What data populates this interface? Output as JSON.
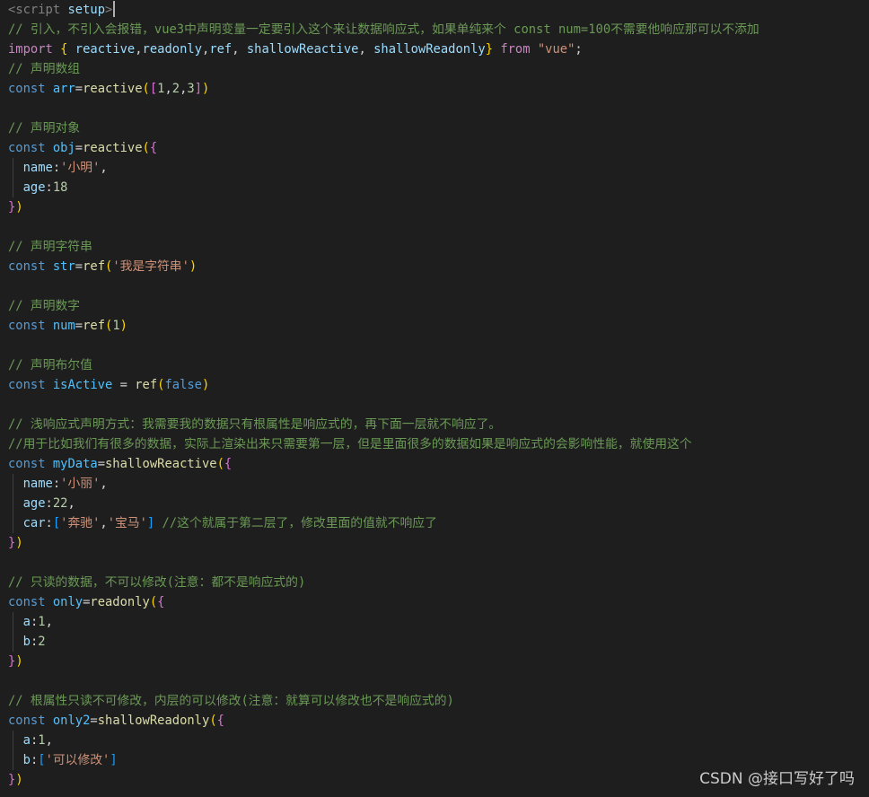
{
  "editor": {
    "language": "vue",
    "colors": {
      "background": "#1e1e1e",
      "comment": "#6a9955",
      "keyword": "#569cd6",
      "control_keyword": "#c586c0",
      "variable": "#4fc1ff",
      "property": "#9cdcfe",
      "function": "#dcdcaa",
      "string": "#ce9178",
      "number": "#b5cea8",
      "bracket_level1": "#ffd700",
      "bracket_level2": "#da70d6",
      "bracket_level3": "#179fff"
    },
    "lines": [
      [
        [
          "tag",
          "<"
        ],
        [
          "tag",
          "script "
        ],
        [
          "attr",
          "setup"
        ],
        [
          "tag",
          ">"
        ],
        [
          "cursor",
          ""
        ]
      ],
      [
        [
          "comment",
          "// 引入，不引入会报错，vue3中声明变量一定要引入这个来让数据响应式，如果单纯来个 const num=100不需要他响应那可以不添加"
        ]
      ],
      [
        [
          "keyword2",
          "import "
        ],
        [
          "brk1",
          "{ "
        ],
        [
          "prop",
          "reactive"
        ],
        [
          "plain",
          ","
        ],
        [
          "prop",
          "readonly"
        ],
        [
          "plain",
          ","
        ],
        [
          "prop",
          "ref"
        ],
        [
          "plain",
          ", "
        ],
        [
          "prop",
          "shallowReactive"
        ],
        [
          "plain",
          ", "
        ],
        [
          "prop",
          "shallowReadonly"
        ],
        [
          "brk1",
          "}"
        ],
        [
          "keyword2",
          " from "
        ],
        [
          "string",
          "\"vue\""
        ],
        [
          "plain",
          ";"
        ]
      ],
      [
        [
          "comment",
          "// 声明数组"
        ]
      ],
      [
        [
          "keyword",
          "const "
        ],
        [
          "var",
          "arr"
        ],
        [
          "plain",
          "="
        ],
        [
          "func",
          "reactive"
        ],
        [
          "brk1",
          "("
        ],
        [
          "brk2",
          "["
        ],
        [
          "number",
          "1"
        ],
        [
          "plain",
          ","
        ],
        [
          "number",
          "2"
        ],
        [
          "plain",
          ","
        ],
        [
          "number",
          "3"
        ],
        [
          "brk2",
          "]"
        ],
        [
          "brk1",
          ")"
        ]
      ],
      [],
      [
        [
          "comment",
          "// 声明对象"
        ]
      ],
      [
        [
          "keyword",
          "const "
        ],
        [
          "var",
          "obj"
        ],
        [
          "plain",
          "="
        ],
        [
          "func",
          "reactive"
        ],
        [
          "brk1",
          "("
        ],
        [
          "brk2",
          "{"
        ]
      ],
      [
        [
          "guide",
          ""
        ],
        [
          "plain",
          "  "
        ],
        [
          "prop",
          "name"
        ],
        [
          "plain",
          ":"
        ],
        [
          "string",
          "'小明'"
        ],
        [
          "plain",
          ","
        ]
      ],
      [
        [
          "guide",
          ""
        ],
        [
          "plain",
          "  "
        ],
        [
          "prop",
          "age"
        ],
        [
          "plain",
          ":"
        ],
        [
          "number",
          "18"
        ]
      ],
      [
        [
          "brk2",
          "}"
        ],
        [
          "brk1",
          ")"
        ]
      ],
      [],
      [
        [
          "comment",
          "// 声明字符串"
        ]
      ],
      [
        [
          "keyword",
          "const "
        ],
        [
          "var",
          "str"
        ],
        [
          "plain",
          "="
        ],
        [
          "func",
          "ref"
        ],
        [
          "brk1",
          "("
        ],
        [
          "string",
          "'我是字符串'"
        ],
        [
          "brk1",
          ")"
        ]
      ],
      [],
      [
        [
          "comment",
          "// 声明数字"
        ]
      ],
      [
        [
          "keyword",
          "const "
        ],
        [
          "var",
          "num"
        ],
        [
          "plain",
          "="
        ],
        [
          "func",
          "ref"
        ],
        [
          "brk1",
          "("
        ],
        [
          "number",
          "1"
        ],
        [
          "brk1",
          ")"
        ]
      ],
      [],
      [
        [
          "comment",
          "// 声明布尔值"
        ]
      ],
      [
        [
          "keyword",
          "const "
        ],
        [
          "var",
          "isActive"
        ],
        [
          "plain",
          " = "
        ],
        [
          "func",
          "ref"
        ],
        [
          "brk1",
          "("
        ],
        [
          "keyword",
          "false"
        ],
        [
          "brk1",
          ")"
        ]
      ],
      [],
      [
        [
          "comment",
          "// 浅响应式声明方式：我需要我的数据只有根属性是响应式的，再下面一层就不响应了。"
        ]
      ],
      [
        [
          "comment",
          "//用于比如我们有很多的数据，实际上渲染出来只需要第一层，但是里面很多的数据如果是响应式的会影响性能，就使用这个"
        ]
      ],
      [
        [
          "keyword",
          "const "
        ],
        [
          "var",
          "myData"
        ],
        [
          "plain",
          "="
        ],
        [
          "func",
          "shallowReactive"
        ],
        [
          "brk1",
          "("
        ],
        [
          "brk2",
          "{"
        ]
      ],
      [
        [
          "guide",
          ""
        ],
        [
          "plain",
          "  "
        ],
        [
          "prop",
          "name"
        ],
        [
          "plain",
          ":"
        ],
        [
          "string",
          "'小丽'"
        ],
        [
          "plain",
          ","
        ]
      ],
      [
        [
          "guide",
          ""
        ],
        [
          "plain",
          "  "
        ],
        [
          "prop",
          "age"
        ],
        [
          "plain",
          ":"
        ],
        [
          "number",
          "22"
        ],
        [
          "plain",
          ","
        ]
      ],
      [
        [
          "guide",
          ""
        ],
        [
          "plain",
          "  "
        ],
        [
          "prop",
          "car"
        ],
        [
          "plain",
          ":"
        ],
        [
          "brk3",
          "["
        ],
        [
          "string",
          "'奔驰'"
        ],
        [
          "plain",
          ","
        ],
        [
          "string",
          "'宝马'"
        ],
        [
          "brk3",
          "]"
        ],
        [
          "comment",
          " //这个就属于第二层了，修改里面的值就不响应了"
        ]
      ],
      [
        [
          "brk2",
          "}"
        ],
        [
          "brk1",
          ")"
        ]
      ],
      [],
      [
        [
          "comment",
          "// 只读的数据，不可以修改(注意：都不是响应式的)"
        ]
      ],
      [
        [
          "keyword",
          "const "
        ],
        [
          "var",
          "only"
        ],
        [
          "plain",
          "="
        ],
        [
          "func",
          "readonly"
        ],
        [
          "brk1",
          "("
        ],
        [
          "brk2",
          "{"
        ]
      ],
      [
        [
          "guide",
          ""
        ],
        [
          "plain",
          "  "
        ],
        [
          "prop",
          "a"
        ],
        [
          "plain",
          ":"
        ],
        [
          "number",
          "1"
        ],
        [
          "plain",
          ","
        ]
      ],
      [
        [
          "guide",
          ""
        ],
        [
          "plain",
          "  "
        ],
        [
          "prop",
          "b"
        ],
        [
          "plain",
          ":"
        ],
        [
          "number",
          "2"
        ]
      ],
      [
        [
          "brk2",
          "}"
        ],
        [
          "brk1",
          ")"
        ]
      ],
      [],
      [
        [
          "comment",
          "// 根属性只读不可修改，内层的可以修改(注意：就算可以修改也不是响应式的)"
        ]
      ],
      [
        [
          "keyword",
          "const "
        ],
        [
          "var",
          "only2"
        ],
        [
          "plain",
          "="
        ],
        [
          "func",
          "shallowReadonly"
        ],
        [
          "brk1",
          "("
        ],
        [
          "brk2",
          "{"
        ]
      ],
      [
        [
          "guide",
          ""
        ],
        [
          "plain",
          "  "
        ],
        [
          "prop",
          "a"
        ],
        [
          "plain",
          ":"
        ],
        [
          "number",
          "1"
        ],
        [
          "plain",
          ","
        ]
      ],
      [
        [
          "guide",
          ""
        ],
        [
          "plain",
          "  "
        ],
        [
          "prop",
          "b"
        ],
        [
          "plain",
          ":"
        ],
        [
          "brk3",
          "["
        ],
        [
          "string",
          "'可以修改'"
        ],
        [
          "brk3",
          "]"
        ]
      ],
      [
        [
          "brk2",
          "}"
        ],
        [
          "brk1",
          ")"
        ]
      ]
    ]
  },
  "watermark": {
    "text": "CSDN @接口写好了吗"
  }
}
